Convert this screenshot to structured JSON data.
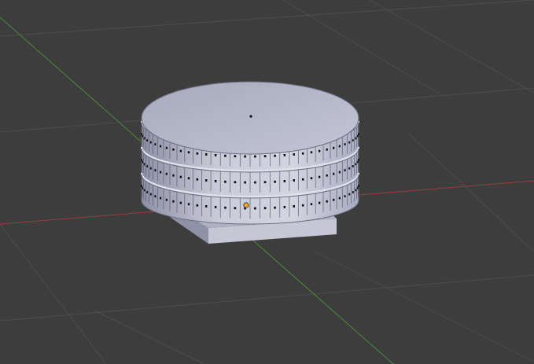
{
  "viewport": {
    "background": "#3d3d3d",
    "grid_color": "#4b4b4b",
    "x_axis_color": "#9a3a3a",
    "y_axis_color": "#4f8a3c"
  },
  "object": {
    "shape": "cylinder",
    "name": "",
    "ring_count": 3,
    "face_color": "#c8cad8",
    "top_color": "#b8bacb",
    "vertex_color": "#0a0a0a",
    "origin_color": "#f2a33a"
  }
}
